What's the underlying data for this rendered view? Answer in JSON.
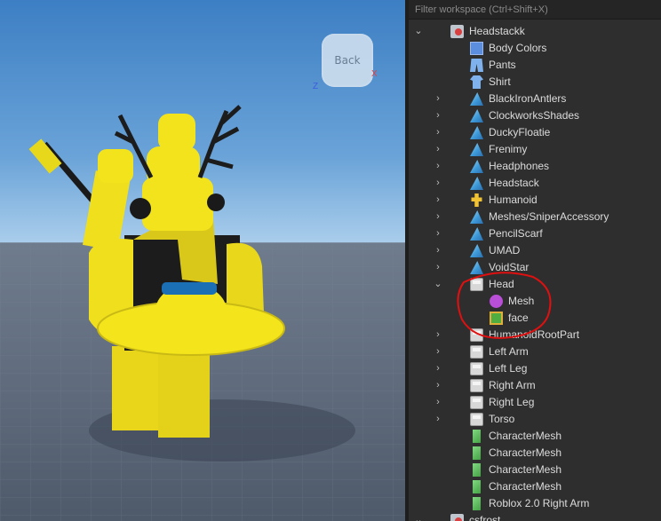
{
  "viewport": {
    "view_cube_label": "Back",
    "axis_x": "X",
    "axis_z": "Z"
  },
  "explorer": {
    "filter_placeholder": "Filter workspace (Ctrl+Shift+X)",
    "items": [
      {
        "label": "Headstackk",
        "icon": "model-icon",
        "depth": 0,
        "expand": "expanded"
      },
      {
        "label": "Body Colors",
        "icon": "body-colors-icon",
        "depth": 1,
        "expand": "none"
      },
      {
        "label": "Pants",
        "icon": "pants-icon",
        "depth": 1,
        "expand": "none"
      },
      {
        "label": "Shirt",
        "icon": "shirt-icon",
        "depth": 1,
        "expand": "none"
      },
      {
        "label": "BlackIronAntlers",
        "icon": "accessory-icon",
        "depth": 1,
        "expand": "collapsed"
      },
      {
        "label": "ClockworksShades",
        "icon": "accessory-icon",
        "depth": 1,
        "expand": "collapsed"
      },
      {
        "label": "DuckyFloatie",
        "icon": "accessory-icon",
        "depth": 1,
        "expand": "collapsed"
      },
      {
        "label": "Frenimy",
        "icon": "accessory-icon",
        "depth": 1,
        "expand": "collapsed"
      },
      {
        "label": "Headphones",
        "icon": "accessory-icon",
        "depth": 1,
        "expand": "collapsed"
      },
      {
        "label": "Headstack",
        "icon": "accessory-icon",
        "depth": 1,
        "expand": "collapsed"
      },
      {
        "label": "Humanoid",
        "icon": "humanoid-icon",
        "depth": 1,
        "expand": "collapsed"
      },
      {
        "label": "Meshes/SniperAccessory",
        "icon": "accessory-icon",
        "depth": 1,
        "expand": "collapsed"
      },
      {
        "label": "PencilScarf",
        "icon": "accessory-icon",
        "depth": 1,
        "expand": "collapsed"
      },
      {
        "label": "UMAD",
        "icon": "accessory-icon",
        "depth": 1,
        "expand": "collapsed"
      },
      {
        "label": "VoidStar",
        "icon": "accessory-icon",
        "depth": 1,
        "expand": "collapsed"
      },
      {
        "label": "Head",
        "icon": "part-icon",
        "depth": 1,
        "expand": "expanded"
      },
      {
        "label": "Mesh",
        "icon": "mesh-icon",
        "depth": 2,
        "expand": "none"
      },
      {
        "label": "face",
        "icon": "decal-icon",
        "depth": 2,
        "expand": "none"
      },
      {
        "label": "HumanoidRootPart",
        "icon": "part-icon",
        "depth": 1,
        "expand": "collapsed"
      },
      {
        "label": "Left Arm",
        "icon": "part-icon",
        "depth": 1,
        "expand": "collapsed"
      },
      {
        "label": "Left Leg",
        "icon": "part-icon",
        "depth": 1,
        "expand": "collapsed"
      },
      {
        "label": "Right Arm",
        "icon": "part-icon",
        "depth": 1,
        "expand": "collapsed"
      },
      {
        "label": "Right Leg",
        "icon": "part-icon",
        "depth": 1,
        "expand": "collapsed"
      },
      {
        "label": "Torso",
        "icon": "part-icon",
        "depth": 1,
        "expand": "collapsed"
      },
      {
        "label": "CharacterMesh",
        "icon": "character-mesh-icon",
        "depth": 1,
        "expand": "none"
      },
      {
        "label": "CharacterMesh",
        "icon": "character-mesh-icon",
        "depth": 1,
        "expand": "none"
      },
      {
        "label": "CharacterMesh",
        "icon": "character-mesh-icon",
        "depth": 1,
        "expand": "none"
      },
      {
        "label": "CharacterMesh",
        "icon": "character-mesh-icon",
        "depth": 1,
        "expand": "none"
      },
      {
        "label": "Roblox 2.0 Right Arm",
        "icon": "character-mesh-icon",
        "depth": 1,
        "expand": "none"
      },
      {
        "label": "csfrost",
        "icon": "model-icon",
        "depth": 0,
        "expand": "expanded"
      }
    ]
  },
  "colors": {
    "panel_bg": "#2e2e2e",
    "annotation": "#e01010",
    "avatar_yellow": "#f2e31c"
  }
}
